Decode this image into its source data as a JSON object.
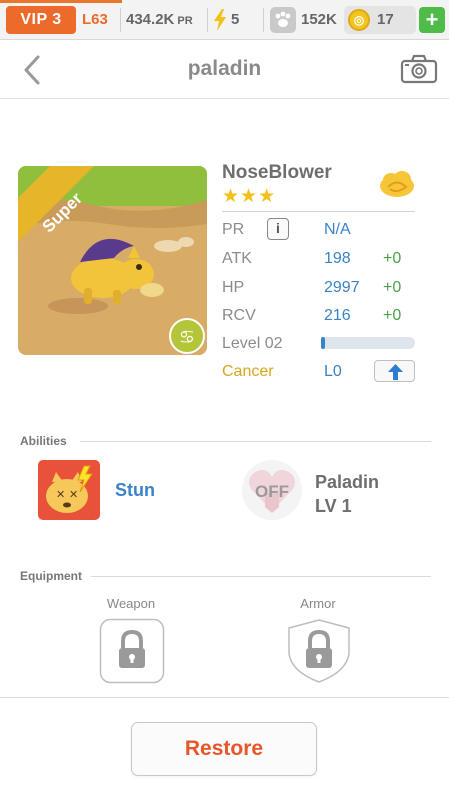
{
  "topbar": {
    "vip_label": "VIP 3",
    "level": "L63",
    "power": "434.2K",
    "power_unit": "PR",
    "energy": "5",
    "paws": "152K",
    "coins": "17",
    "add_icon": "plus-icon",
    "accent": "#ec6a2a"
  },
  "header": {
    "title": "paladin",
    "back_icon": "chevron-left-icon",
    "camera_icon": "camera-icon"
  },
  "pet": {
    "badge": "Super",
    "name": "NoseBlower",
    "stars": "★★★",
    "star_count": 3,
    "food_icon": "cloud-food-icon",
    "zodiac_icon": "cancer-zodiac-icon",
    "stats": {
      "pr": {
        "label": "PR",
        "value": "N/A"
      },
      "atk": {
        "label": "ATK",
        "value": "198",
        "bonus": "+0"
      },
      "hp": {
        "label": "HP",
        "value": "2997",
        "bonus": "+0"
      },
      "rcv": {
        "label": "RCV",
        "value": "216",
        "bonus": "+0"
      },
      "level": {
        "label": "Level 02",
        "progress": 0.02
      }
    },
    "info_label": "i",
    "zodiac": {
      "label": "Cancer",
      "rank": "L0"
    }
  },
  "abilities": {
    "heading": "Abilities",
    "skill": {
      "name": "Stun",
      "icon": "stun-icon"
    },
    "class": {
      "badge": "OFF",
      "name": "Paladin",
      "level": "LV 1",
      "icon": "heart-shield-icon"
    }
  },
  "equipment": {
    "heading": "Equipment",
    "weapon_label": "Weapon",
    "armor_label": "Armor"
  },
  "footer": {
    "restore_label": "Restore"
  },
  "colors": {
    "stat_blue": "#3a83c8",
    "bonus_green": "#4aa14a",
    "zodiac_gold": "#d6a81d",
    "restore_red": "#e8552a"
  }
}
